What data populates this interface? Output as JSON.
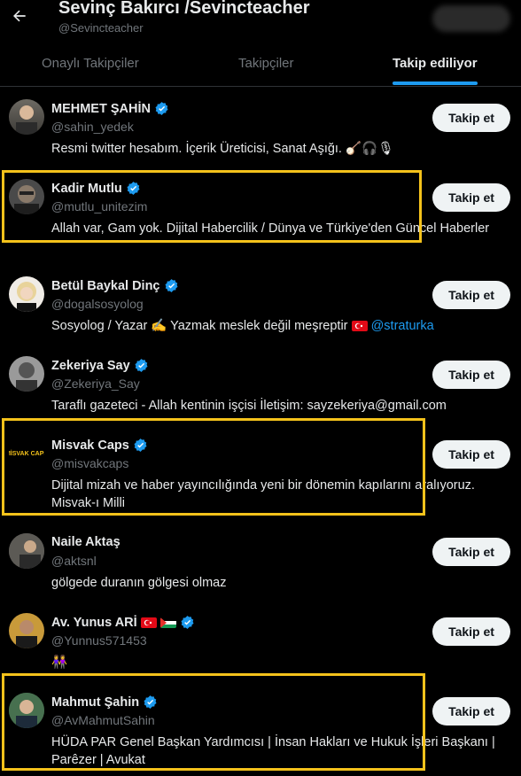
{
  "header": {
    "title": "Sevinç Bakırcı /Sevincteacher",
    "handle": "@Sevincteacher"
  },
  "tabs": [
    {
      "label": "Onaylı Takipçiler"
    },
    {
      "label": "Takipçiler"
    },
    {
      "label": "Takip ediliyor"
    }
  ],
  "follow_label": "Takip et",
  "users": [
    {
      "name": "MEHMET ŞAHİN",
      "handle": "@sahin_yedek",
      "bio": "Resmi twitter hesabım. İçerik Üreticisi, Sanat Aşığı. 🪕🎧🎙"
    },
    {
      "name": "Kadir Mutlu",
      "handle": "@mutlu_unitezim",
      "bio": "Allah var, Gam yok. Dijital Habercilik / Dünya ve Türkiye'den Güncel Haberler"
    },
    {
      "name": "Betül Baykal Dinç",
      "handle": "@dogalsosyolog",
      "bio": "Sosyolog / Yazar ✍️ Yazmak meslek değil meşreptir",
      "mention": "@straturka"
    },
    {
      "name": "Zekeriya Say",
      "handle": "@Zekeriya_Say",
      "bio": "Taraflı gazeteci - Allah kentinin işçisi İletişim: sayzekeriya@gmail.com"
    },
    {
      "name": "Misvak Caps",
      "handle": "@misvakcaps",
      "bio": "Dijital mizah ve haber yayıncılığında yeni bir dönemin kapılarını aralıyoruz. Misvak-ı Milli",
      "logo_text": "MİSVAK CAPS"
    },
    {
      "name": "Naile Aktaş",
      "handle": "@aktsnl",
      "bio": "gölgede duranın gölgesi olmaz"
    },
    {
      "name": "Av. Yunus ARİ",
      "handle": "@Yunnus571453",
      "bio": "👭"
    },
    {
      "name": "Mahmut Şahin",
      "handle": "@AvMahmutSahin",
      "bio": "HÜDA PAR Genel Başkan Yardımcısı | İnsan Hakları ve Hukuk İşleri Başkanı | Parêzer | Avukat"
    }
  ],
  "colors": {
    "accent": "#1d9bf0",
    "highlight": "#f4c21b"
  }
}
